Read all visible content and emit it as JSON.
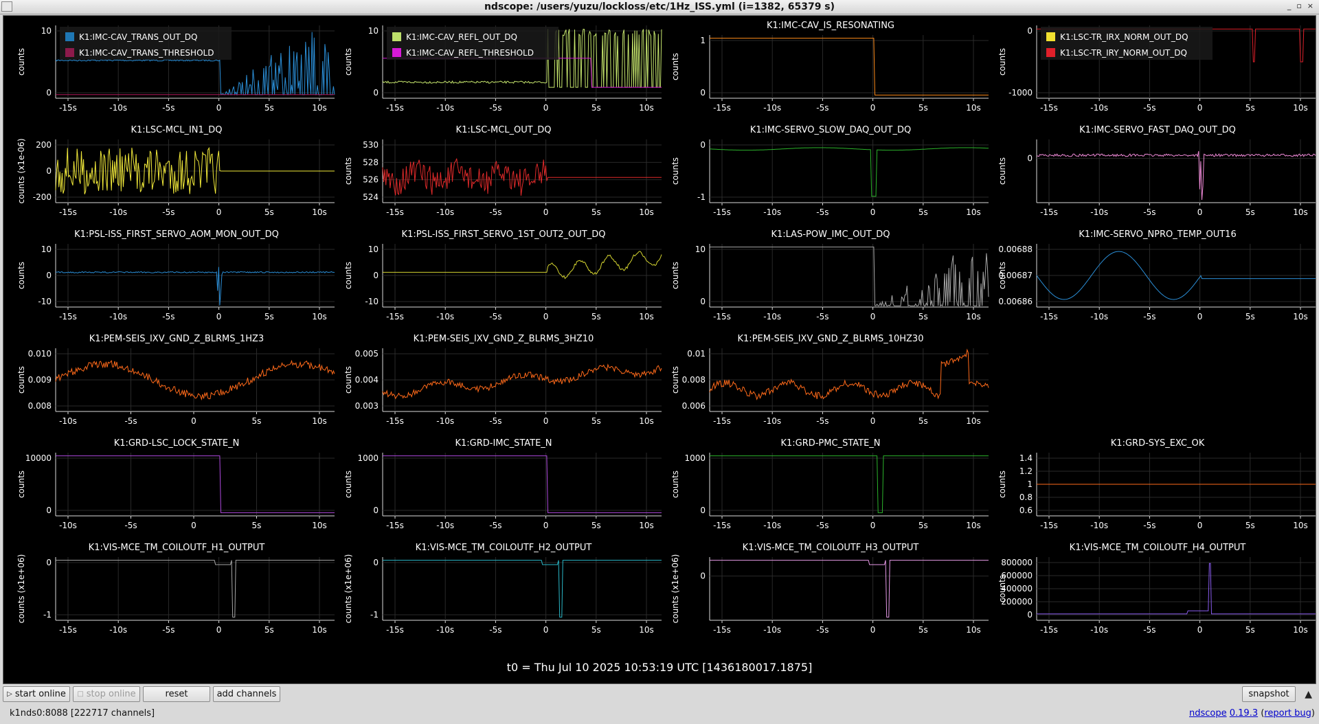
{
  "window": {
    "title": "ndscope: /users/yuzu/lockloss/etc/1Hz_ISS.yml (i=1382, 65379 s)",
    "buttons": [
      "_",
      "▫",
      "×"
    ]
  },
  "t0_label": "t0 = Thu Jul 10 2025 10:53:19 UTC [1436180017.1875]",
  "plots": [
    {
      "ylabel": "counts",
      "yticks": [
        "10",
        "0"
      ],
      "xticks": [
        "-15s",
        "-10s",
        "-5s",
        "0",
        "5s",
        "10s"
      ],
      "legend": [
        {
          "name": "K1:IMC-CAV_TRANS_OUT_DQ",
          "color": "#1f77b4"
        },
        {
          "name": "K1:IMC-CAV_TRANS_THRESHOLD",
          "color": "#8c1a4b"
        }
      ],
      "traces": [
        {
          "color": "#2b8fd8",
          "style": "dense_after"
        },
        {
          "color": "#b0185a",
          "style": "flat"
        }
      ]
    },
    {
      "ylabel": "counts",
      "yticks": [
        "10",
        "0"
      ],
      "xticks": [
        "-15s",
        "-10s",
        "-5s",
        "0",
        "5s",
        "10s"
      ],
      "legend": [
        {
          "name": "K1:IMC-CAV_REFL_OUT_DQ",
          "color": "#bde06b"
        },
        {
          "name": "K1:IMC-CAV_REFL_THRESHOLD",
          "color": "#d61ad6"
        }
      ],
      "traces": [
        {
          "color": "#c8e86e",
          "style": "dense_after_high"
        },
        {
          "color": "#d61ad6",
          "style": "step_mid"
        }
      ]
    },
    {
      "title": "K1:IMC-CAV_IS_RESONATING",
      "ylabel": "counts",
      "yticks": [
        "1",
        "0"
      ],
      "xticks": [
        "-15s",
        "-10s",
        "-5s",
        "0",
        "5s",
        "10s"
      ],
      "traces": [
        {
          "color": "#ff8c1a",
          "style": "step_down"
        }
      ]
    },
    {
      "ylabel": "counts",
      "yticks": [
        "0",
        "-1000"
      ],
      "xticks": [
        "-15s",
        "-10s",
        "-5s",
        "0",
        "5s",
        "10s"
      ],
      "legend": [
        {
          "name": "K1:LSC-TR_IRX_NORM_OUT_DQ",
          "color": "#f0e030"
        },
        {
          "name": "K1:LSC-TR_IRY_NORM_OUT_DQ",
          "color": "#e0202a"
        }
      ],
      "traces": [
        {
          "color": "#e0202a",
          "style": "flat_top_spikes"
        }
      ]
    },
    {
      "title": "K1:LSC-MCL_IN1_DQ",
      "ylabel": "counts (x1e-06)",
      "yticks": [
        "200",
        "0",
        "-200"
      ],
      "xticks": [
        "-15s",
        "-10s",
        "-5s",
        "0",
        "5s",
        "10s"
      ],
      "traces": [
        {
          "color": "#f2ea3a",
          "style": "noise_wide"
        }
      ]
    },
    {
      "title": "K1:LSC-MCL_OUT_DQ",
      "ylabel": "counts",
      "yticks": [
        "530",
        "528",
        "526",
        "524"
      ],
      "xticks": [
        "-15s",
        "-10s",
        "-5s",
        "0",
        "5s",
        "10s"
      ],
      "traces": [
        {
          "color": "#e02a2a",
          "style": "noise_mid"
        }
      ]
    },
    {
      "title": "K1:IMC-SERVO_SLOW_DAQ_OUT_DQ",
      "ylabel": "counts",
      "yticks": [
        "0",
        "-1"
      ],
      "xticks": [
        "-15s",
        "-10s",
        "-5s",
        "0",
        "5s",
        "10s"
      ],
      "traces": [
        {
          "color": "#2cb52c",
          "style": "dip_top"
        }
      ]
    },
    {
      "title": "K1:IMC-SERVO_FAST_DAQ_OUT_DQ",
      "ylabel": "counts",
      "yticks": [
        "0"
      ],
      "xticks": [
        "-15s",
        "-10s",
        "-5s",
        "0",
        "5s",
        "10s"
      ],
      "traces": [
        {
          "color": "#f08ad8",
          "style": "thin_band_spike"
        }
      ]
    },
    {
      "title": "K1:PSL-ISS_FIRST_SERVO_AOM_MON_OUT_DQ",
      "ylabel": "counts",
      "yticks": [
        "10",
        "0",
        "-10"
      ],
      "xticks": [
        "-15s",
        "-10s",
        "-5s",
        "0",
        "5s",
        "10s"
      ],
      "traces": [
        {
          "color": "#2b8fd8",
          "style": "flat_burst"
        }
      ]
    },
    {
      "title": "K1:PSL-ISS_FIRST_SERVO_1ST_OUT2_OUT_DQ",
      "ylabel": "counts",
      "yticks": [
        "10",
        "0",
        "-10"
      ],
      "xticks": [
        "-15s",
        "-10s",
        "-5s",
        "0",
        "5s",
        "10s"
      ],
      "traces": [
        {
          "color": "#d4d430",
          "style": "flat_then_wiggle"
        }
      ]
    },
    {
      "title": "K1:LAS-POW_IMC_OUT_DQ",
      "ylabel": "counts",
      "yticks": [
        "10",
        "0"
      ],
      "xticks": [
        "-15s",
        "-10s",
        "-5s",
        "0",
        "5s",
        "10s"
      ],
      "traces": [
        {
          "color": "#a8a8a8",
          "style": "high_then_dense"
        }
      ]
    },
    {
      "title": "K1:IMC-SERVO_NPRO_TEMP_OUT16",
      "ylabel": "counts",
      "yticks": [
        "0.00688",
        "0.00687",
        "0.00686"
      ],
      "xticks": [
        "-15s",
        "-10s",
        "-5s",
        "0",
        "5s",
        "10s"
      ],
      "traces": [
        {
          "color": "#2b8fd8",
          "style": "slow_wave"
        }
      ]
    },
    {
      "title": "K1:PEM-SEIS_IXV_GND_Z_BLRMS_1HZ3",
      "ylabel": "counts",
      "yticks": [
        "0.010",
        "0.009",
        "0.008"
      ],
      "xticks": [
        "-10s",
        "-5s",
        "0",
        "5s",
        "10s"
      ],
      "traces": [
        {
          "color": "#ff6a1a",
          "style": "slow_noise"
        }
      ]
    },
    {
      "title": "K1:PEM-SEIS_IXV_GND_Z_BLRMS_3HZ10",
      "ylabel": "counts",
      "yticks": [
        "0.005",
        "0.004",
        "0.003"
      ],
      "xticks": [
        "-15s",
        "-10s",
        "-5s",
        "0",
        "5s",
        "10s"
      ],
      "traces": [
        {
          "color": "#ff6a1a",
          "style": "slow_noise_rise"
        }
      ]
    },
    {
      "title": "K1:PEM-SEIS_IXV_GND_Z_BLRMS_10HZ30",
      "ylabel": "counts",
      "yticks": [
        "0.01",
        "0.008",
        "0.006"
      ],
      "xticks": [
        "-15s",
        "-10s",
        "-5s",
        "0",
        "5s",
        "10s"
      ],
      "traces": [
        {
          "color": "#ff6a1a",
          "style": "slow_noise_peak"
        }
      ]
    },
    null,
    {
      "title": "K1:GRD-LSC_LOCK_STATE_N",
      "ylabel": "counts",
      "yticks": [
        "10000",
        "0"
      ],
      "xticks": [
        "-10s",
        "-5s",
        "0",
        "5s",
        "10s"
      ],
      "traces": [
        {
          "color": "#b04ae0",
          "style": "step_down"
        }
      ]
    },
    {
      "title": "K1:GRD-IMC_STATE_N",
      "ylabel": "counts",
      "yticks": [
        "1000",
        "0"
      ],
      "xticks": [
        "-15s",
        "-10s",
        "-5s",
        "0",
        "5s",
        "10s"
      ],
      "traces": [
        {
          "color": "#b04ae0",
          "style": "step_down"
        }
      ]
    },
    {
      "title": "K1:GRD-PMC_STATE_N",
      "ylabel": "counts",
      "yticks": [
        "1000",
        "0"
      ],
      "xticks": [
        "-15s",
        "-10s",
        "-5s",
        "0",
        "5s",
        "10s"
      ],
      "traces": [
        {
          "color": "#2cb52c",
          "style": "top_dip"
        }
      ]
    },
    {
      "title": "K1:GRD-SYS_EXC_OK",
      "ylabel": "counts",
      "yticks": [
        "1.4",
        "1.2",
        "1",
        "0.8",
        "0.6"
      ],
      "xticks": [
        "-15s",
        "-10s",
        "-5s",
        "0",
        "5s",
        "10s"
      ],
      "traces": [
        {
          "color": "#ff6a1a",
          "style": "flat_mid"
        }
      ]
    },
    {
      "title": "K1:VIS-MCE_TM_COILOUTF_H1_OUTPUT",
      "ylabel": "counts (x1e+06)",
      "yticks": [
        "0",
        "-1"
      ],
      "xticks": [
        "-15s",
        "-10s",
        "-5s",
        "0",
        "5s",
        "10s"
      ],
      "traces": [
        {
          "color": "#a8a8a8",
          "style": "top_spike_down"
        }
      ]
    },
    {
      "title": "K1:VIS-MCE_TM_COILOUTF_H2_OUTPUT",
      "ylabel": "counts (x1e+06)",
      "yticks": [
        "0",
        "-1"
      ],
      "xticks": [
        "-15s",
        "-10s",
        "-5s",
        "0",
        "5s",
        "10s"
      ],
      "traces": [
        {
          "color": "#2ab8c8",
          "style": "top_spike_down"
        }
      ]
    },
    {
      "title": "K1:VIS-MCE_TM_COILOUTF_H3_OUTPUT",
      "ylabel": "counts (x1e+06)",
      "yticks": [
        "0"
      ],
      "xticks": [
        "-15s",
        "-10s",
        "-5s",
        "0",
        "5s",
        "10s"
      ],
      "traces": [
        {
          "color": "#e79ae8",
          "style": "top_spike_down"
        }
      ]
    },
    {
      "title": "K1:VIS-MCE_TM_COILOUTF_H4_OUTPUT",
      "ylabel": "counts",
      "yticks": [
        "800000",
        "600000",
        "400000",
        "200000",
        "0"
      ],
      "xticks": [
        "-15s",
        "-10s",
        "-5s",
        "0",
        "5s",
        "10s"
      ],
      "traces": [
        {
          "color": "#8a5cf0",
          "style": "bottom_spike_up"
        }
      ]
    }
  ],
  "toolbar": {
    "start_online": "start online",
    "stop_online": "stop online",
    "reset": "reset",
    "add_channels": "add channels",
    "snapshot": "snapshot"
  },
  "status": {
    "server": "k1nds0:8088  [222717 channels]",
    "app_name": "ndscope",
    "version": "0.19.3",
    "report_bug": "report bug"
  }
}
